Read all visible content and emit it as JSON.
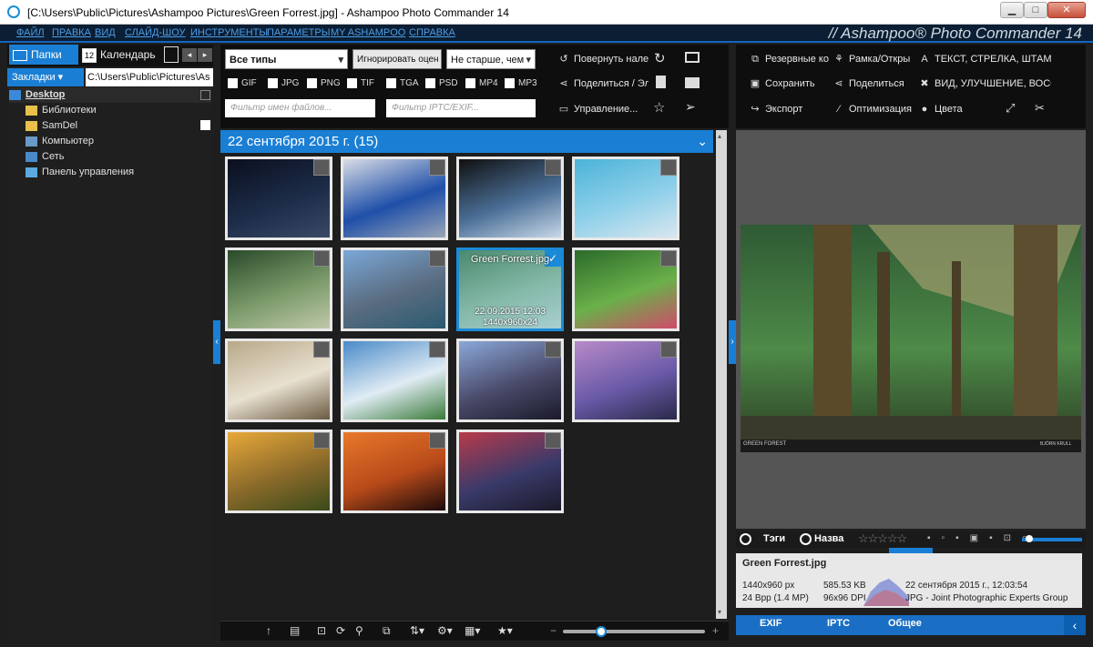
{
  "window": {
    "title": "[C:\\Users\\Public\\Pictures\\Ashampoo Pictures\\Green Forrest.jpg] - Ashampoo Photo Commander 14",
    "minimize_label": "▁",
    "maximize_label": "□",
    "close_label": "✕"
  },
  "menu": {
    "items": [
      "ФАЙЛ",
      "ПРАВКА",
      "ВИД",
      "СЛАЙД-ШОУ",
      "ИНСТРУМЕНТЫ",
      "ПАРАМЕТРЫ",
      "MY ASHAMPOO",
      "СПРАВКА"
    ],
    "brand": "// Ashampoo® Photo Commander 14"
  },
  "left": {
    "tab_folders": "Папки",
    "tab_calendar": "Календарь",
    "calendar_day": "12",
    "bookmarks": "Закладки",
    "path": "C:\\Users\\Public\\Pictures\\As",
    "tree": [
      "Desktop",
      "Библиотеки",
      "SamDel",
      "Компьютер",
      "Сеть",
      "Панель управления"
    ]
  },
  "center_toolbar": {
    "type_combo": "Все типы",
    "ignore_rating": "Игнорировать оцен",
    "age_combo": "Не старше, чем",
    "types": [
      "GIF",
      "JPG",
      "PNG",
      "TIF",
      "TGA",
      "PSD",
      "MP4",
      "MP3"
    ],
    "filter_names_placeholder": "Фильтр имен файлов...",
    "filter_iptc_placeholder": "Фильтр IPTC/EXIF...",
    "rotate_left": "Повернуть нале",
    "share": "Поделиться / Эл",
    "manage": "Управление..."
  },
  "right_toolbar": {
    "backup": "Резервные ко",
    "save": "Сохранить",
    "export": "Экспорт",
    "frame": "Рамка/Откры",
    "share": "Поделиться",
    "optimize": "Оптимизация",
    "text": "ТЕКСТ, СТРЕЛКА, ШТАМП,",
    "view": "ВИД, УЛУЧШЕНИЕ, ВОССТА",
    "colors": "Цвета"
  },
  "group": {
    "title": "22 сентября 2015 г. (15)"
  },
  "thumbnails": [
    {
      "name": "night-promenade",
      "colors": [
        "#0b0f1e",
        "#1c2c48",
        "#3a4a66"
      ]
    },
    {
      "name": "lantern",
      "colors": [
        "#d8dde6",
        "#1f4fa8",
        "#9aa6b8"
      ]
    },
    {
      "name": "porthole",
      "colors": [
        "#101010",
        "#4a6e96",
        "#c8d8e8"
      ]
    },
    {
      "name": "dolphin",
      "colors": [
        "#4bb3d8",
        "#8fd0ea",
        "#d9e6ee"
      ]
    },
    {
      "name": "dragonfly",
      "colors": [
        "#2a4a2a",
        "#7a9a6a",
        "#c0c8a8"
      ]
    },
    {
      "name": "city-marina",
      "colors": [
        "#7aa8d8",
        "#5a6c80",
        "#2a5a70"
      ]
    },
    {
      "name": "green-forrest",
      "colors": [
        "#5a8a4a",
        "#a8c898",
        "#d8e6d0"
      ],
      "label": "Green Forrest.jpg",
      "date": "22.09.2015 12:03",
      "dims": "1440x960x24",
      "selected": true
    },
    {
      "name": "garden-table",
      "colors": [
        "#2a6a2a",
        "#6ab04a",
        "#d04a6a"
      ]
    },
    {
      "name": "goat",
      "colors": [
        "#b8a888",
        "#e8e0d0",
        "#6a5a40"
      ]
    },
    {
      "name": "mountain-lake",
      "colors": [
        "#4a8ac8",
        "#e0ecf4",
        "#3a7a3a"
      ]
    },
    {
      "name": "skyline-dusk",
      "colors": [
        "#8aa8d8",
        "#4a4a6a",
        "#1a1a2a"
      ]
    },
    {
      "name": "purple-skyline",
      "colors": [
        "#b88ac8",
        "#6a5aa8",
        "#2a2a4a"
      ]
    },
    {
      "name": "sunflowers",
      "colors": [
        "#e8a83a",
        "#8a6a2a",
        "#3a4a1a"
      ]
    },
    {
      "name": "palm-sunset",
      "colors": [
        "#e8782a",
        "#b84a1a",
        "#1a0a0a"
      ]
    },
    {
      "name": "times-square",
      "colors": [
        "#b83a4a",
        "#3a3a6a",
        "#1a1a2a"
      ]
    }
  ],
  "preview": {
    "caption_left": "GREEN FOREST",
    "caption_right": "BJÖRN KRULL"
  },
  "right_controls": {
    "tags": "Тэги",
    "names": "Назва"
  },
  "info": {
    "filename": "Green Forrest.jpg",
    "dims": "1440x960 px",
    "bpp": "24 Bpp (1.4 MP)",
    "size": "585.53 KB",
    "dpi": "96x96 DPI",
    "date": "22 сентября 2015 г., 12:03:54",
    "format": "JPG - Joint Photographic Experts Group"
  },
  "info_tabs": [
    "EXIF",
    "IPTC",
    "Общее"
  ],
  "bottom": {
    "zoom_minus": "−",
    "zoom_plus": "+",
    "zoom_level": 0.27
  }
}
